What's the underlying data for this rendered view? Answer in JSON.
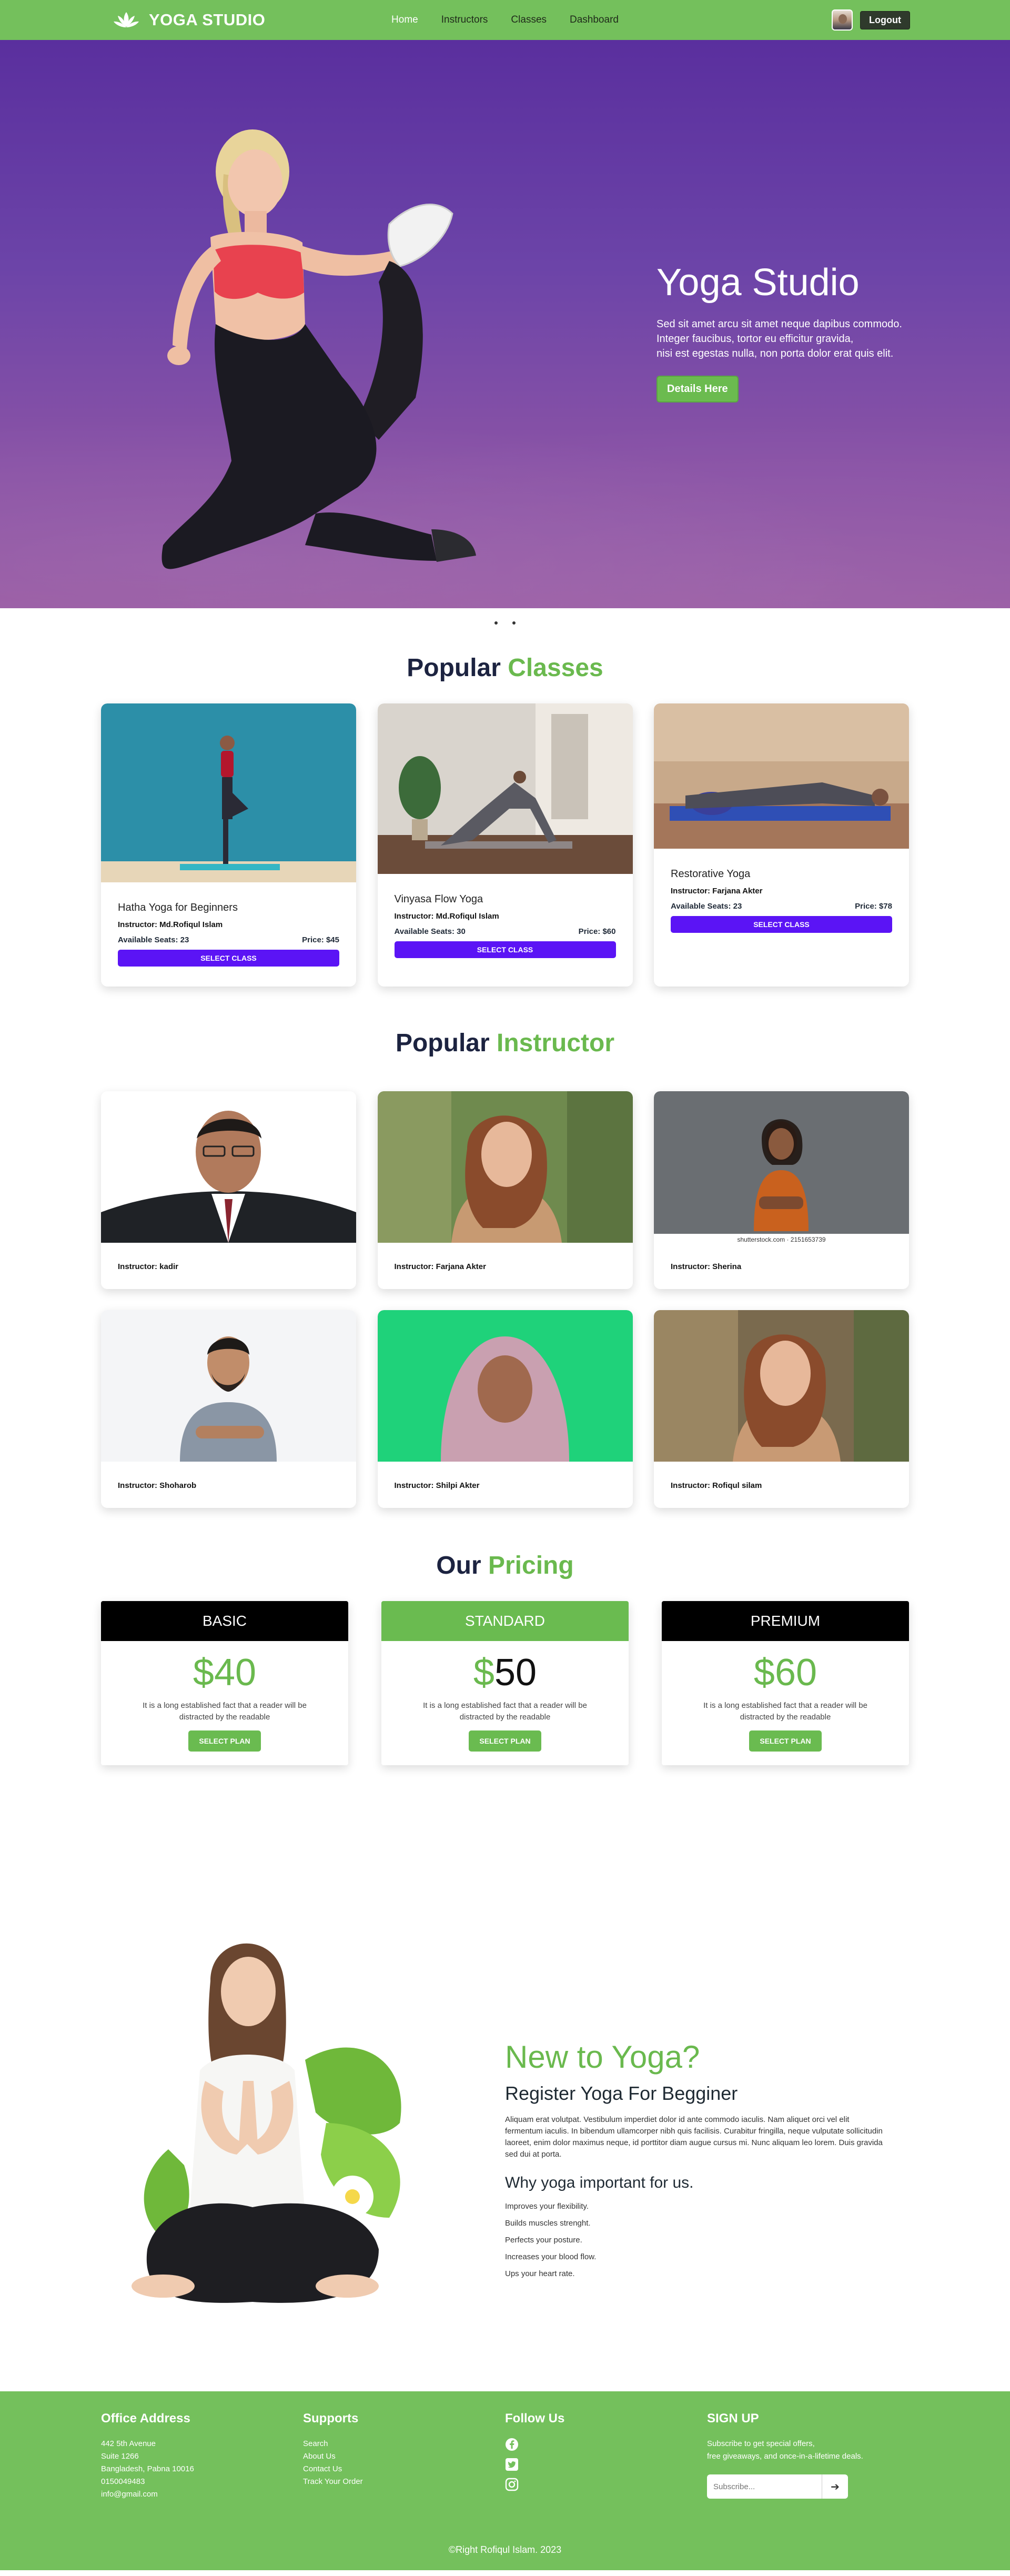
{
  "nav": {
    "brand": "YOGA STUDIO",
    "links": [
      "Home",
      "Instructors",
      "Classes",
      "Dashboard"
    ],
    "logout": "Logout"
  },
  "hero": {
    "title": "Yoga Studio",
    "description_lines": [
      "Sed sit amet arcu sit amet neque dapibus commodo.",
      "Integer faucibus, tortor eu efficitur gravida,",
      "nisi est egestas nulla, non porta dolor erat quis elit."
    ],
    "button": "Details Here"
  },
  "classes": {
    "title": "Popular",
    "title_accent": "Classes",
    "items": [
      {
        "name": "Hatha Yoga for Beginners",
        "instructor": "Instructor: Md.Rofiqul Islam",
        "seats": "Available Seats: 23",
        "price": "Price: $45",
        "button": "SELECT CLASS"
      },
      {
        "name": "Vinyasa Flow Yoga",
        "instructor": "Instructor: Md.Rofiqul Islam",
        "seats": "Available Seats: 30",
        "price": "Price: $60",
        "button": "SELECT CLASS"
      },
      {
        "name": "Restorative Yoga",
        "instructor": "Instructor: Farjana Akter",
        "seats": "Available Seats: 23",
        "price": "Price: $78",
        "button": "SELECT CLASS"
      }
    ]
  },
  "instructors": {
    "title": "Popular",
    "title_accent": "Instructor",
    "items": [
      {
        "name": "Instructor: kadir"
      },
      {
        "name": "Instructor: Farjana Akter"
      },
      {
        "name": "Instructor: Sherina",
        "credit": "shutterstock.com · 2151653739"
      },
      {
        "name": "Instructor: Shoharob"
      },
      {
        "name": "Instructor: Shilpi Akter"
      },
      {
        "name": "Instructor: Rofiqul silam"
      }
    ]
  },
  "pricing": {
    "title": "Our",
    "title_accent": "Pricing",
    "plans": [
      {
        "name": "BASIC",
        "currency": "$",
        "amount": "40",
        "text": "It is a long established fact that a reader will be distracted by the readable",
        "button": "SELECT PLAN"
      },
      {
        "name": "STANDARD",
        "currency": "$",
        "amount": "50",
        "text": "It is a long established fact that a reader will be distracted by the readable",
        "button": "SELECT PLAN"
      },
      {
        "name": "PREMIUM",
        "currency": "$",
        "amount": "60",
        "text": "It is a long established fact that a reader will be distracted by the readable",
        "button": "SELECT PLAN"
      }
    ]
  },
  "new_to_yoga": {
    "title": "New to Yoga?",
    "subtitle": "Register Yoga For Begginer",
    "paragraph": "Aliquam erat volutpat. Vestibulum imperdiet dolor id ante commodo iaculis. Nam aliquet orci vel elit fermentum iaculis. In bibendum ullamcorper nibh quis facilisis. Curabitur fringilla, neque vulputate sollicitudin laoreet, enim dolor maximus neque, id porttitor diam augue cursus mi. Nunc aliquam leo lorem. Duis gravida sed dui at porta.",
    "why_title": "Why yoga important for us.",
    "reasons": [
      "Improves your flexibility.",
      "Builds muscles strenght.",
      "Perfects your posture.",
      "Increases your blood flow.",
      "Ups your heart rate."
    ]
  },
  "footer": {
    "office_title": "Office Address",
    "office_lines": [
      "442 5th Avenue",
      "Suite 1266",
      "Bangladesh, Pabna 10016",
      "0150049483",
      "info@gmail.com"
    ],
    "supports_title": "Supports",
    "supports_links": [
      "Search",
      "About Us",
      "Contact Us",
      "Track Your Order"
    ],
    "follow_title": "Follow Us",
    "signup_title": "SIGN UP",
    "signup_lines": [
      "Subscribe to get special offers,",
      "free giveaways, and once-in-a-lifetime deals."
    ],
    "subscribe_placeholder": "Subscribe...",
    "copyright": "©Right Rofiqul Islam. 2023"
  },
  "colors": {
    "brand_green": "#74c05c",
    "accent_green": "#6ab94e",
    "class_button": "#5b14f5",
    "hero_purple": "#6c44a8"
  },
  "icons": [
    "lotus-icon",
    "facebook-icon",
    "twitter-icon",
    "instagram-icon",
    "arrow-right-icon"
  ]
}
